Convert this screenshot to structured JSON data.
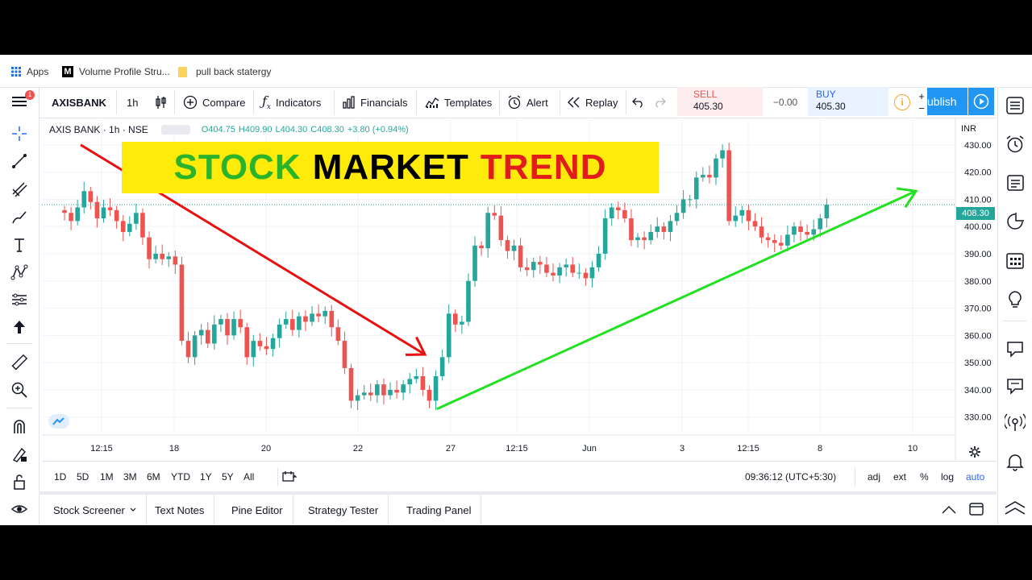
{
  "bookmarks": {
    "apps": "Apps",
    "item1": "Volume Profile Stru...",
    "item2": "pull back statergy"
  },
  "toolbar": {
    "symbol": "AXISBANK",
    "interval": "1h",
    "compare": "Compare",
    "indicators": "Indicators",
    "financials": "Financials",
    "templates": "Templates",
    "alert": "Alert",
    "replay": "Replay",
    "publish": "ublish"
  },
  "menu_badge": "1",
  "trade": {
    "sell_label": "SELL",
    "sell_price": "405.30",
    "spread": "−0.00",
    "buy_label": "BUY",
    "buy_price": "405.30"
  },
  "legend": {
    "title": "AXIS BANK · 1h · NSE",
    "o": "O404.75",
    "h": "H409.90",
    "l": "L404.30",
    "c": "C408.30",
    "chg": "+3.80 (+0.94%)"
  },
  "banner": {
    "w1": "STOCK",
    "w2": "MARKET",
    "w3": "TREND",
    "c1": "#2bb32b",
    "c2": "#000000",
    "c3": "#e21b1b",
    "bg": "#ffeb0a"
  },
  "currency": "INR",
  "last_price": "408.30",
  "colors": {
    "up": "#26a69a",
    "down": "#ef5350",
    "downtrend": "#e81010",
    "uptrend": "#22e022",
    "accent": "#2196f3"
  },
  "chart_data": {
    "type": "candlestick",
    "symbol": "AXISBANK",
    "interval": "1h",
    "exchange": "NSE",
    "ylim": [
      324,
      440
    ],
    "y_ticks": [
      430,
      420,
      410,
      400,
      390,
      380,
      370,
      360,
      350,
      340,
      330
    ],
    "x_ticks": [
      "12:15",
      "18",
      "20",
      "22",
      "27",
      "12:15",
      "Jun",
      "3",
      "12:15",
      "8",
      "10"
    ],
    "close": [
      405,
      402,
      407,
      413,
      409,
      403,
      407,
      406,
      402,
      398,
      401,
      405,
      396,
      388,
      390,
      388,
      389,
      386,
      358,
      352,
      360,
      362,
      357,
      364,
      366,
      360,
      366,
      363,
      352,
      358,
      356,
      355,
      359,
      364,
      366,
      362,
      367,
      365,
      368,
      367,
      369,
      363,
      358,
      348,
      336,
      338,
      339,
      338,
      342,
      338,
      340,
      339,
      342,
      344,
      345,
      340,
      336,
      345,
      352,
      368,
      364,
      365,
      380,
      393,
      392,
      405,
      404,
      395,
      391,
      393,
      385,
      384,
      387,
      386,
      383,
      382,
      385,
      386,
      383,
      383,
      381,
      385,
      390,
      403,
      407,
      406,
      403,
      395,
      396,
      395,
      398,
      400,
      398,
      402,
      405,
      410,
      410,
      418,
      419,
      418,
      425,
      428,
      402,
      404,
      406,
      402,
      400,
      396,
      395,
      394,
      393,
      397,
      400,
      398,
      397,
      399,
      403,
      408
    ],
    "trend_lines": [
      {
        "label": "downtrend",
        "from": [
          "start",
          430
        ],
        "to": [
          "27",
          353
        ]
      },
      {
        "label": "uptrend",
        "from": [
          "27",
          333
        ],
        "to": [
          "10",
          413
        ]
      }
    ]
  },
  "timeframes": [
    "1D",
    "5D",
    "1M",
    "3M",
    "6M",
    "YTD",
    "1Y",
    "5Y",
    "All"
  ],
  "clock": "09:36:12 (UTC+5:30)",
  "scale_opts": {
    "adj": "adj",
    "ext": "ext",
    "pct": "%",
    "log": "log",
    "auto": "auto"
  },
  "bottom_tabs": [
    "Stock Screener",
    "Text Notes",
    "Pine Editor",
    "Strategy Tester",
    "Trading Panel"
  ],
  "left_tools": [
    "cross-icon",
    "trend-line-icon",
    "fib-icon",
    "brush-icon",
    "text-icon",
    "pattern-icon",
    "prediction-icon",
    "arrow-up-icon",
    "ruler-icon",
    "zoom-in-icon",
    "magnet-icon",
    "lock-draw-icon",
    "lock-icon",
    "eye-icon"
  ],
  "right_tools": [
    "watchlist-icon",
    "alarm-clock-icon",
    "news-icon",
    "data-window-icon",
    "calendar-icon",
    "ideas-icon",
    "chat-icon",
    "streams-icon",
    "broadcast-icon",
    "bell-icon",
    "chevron-icon"
  ]
}
